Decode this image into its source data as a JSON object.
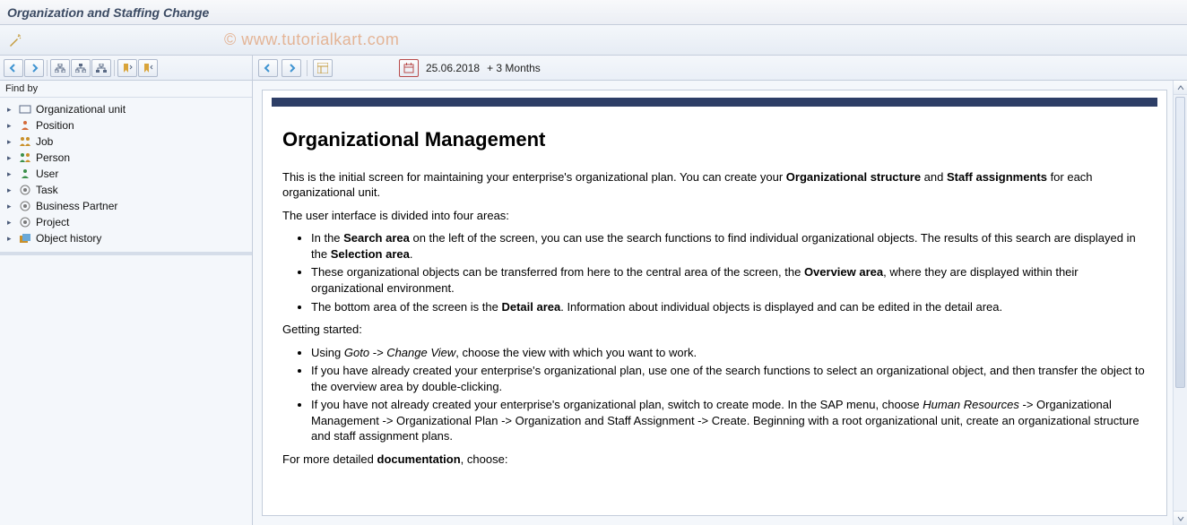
{
  "titlebar": {
    "title": "Organization and Staffing Change"
  },
  "watermark": "© www.tutorialkart.com",
  "left": {
    "findby_label": "Find by",
    "items": [
      {
        "label": "Organizational unit",
        "icon": "org-unit"
      },
      {
        "label": "Position",
        "icon": "position"
      },
      {
        "label": "Job",
        "icon": "job"
      },
      {
        "label": "Person",
        "icon": "person"
      },
      {
        "label": "User",
        "icon": "user"
      },
      {
        "label": "Task",
        "icon": "task"
      },
      {
        "label": "Business Partner",
        "icon": "bp"
      },
      {
        "label": "Project",
        "icon": "project"
      },
      {
        "label": "Object history",
        "icon": "history"
      }
    ]
  },
  "right_toolbar": {
    "date": "25.06.2018",
    "period": "+ 3 Months"
  },
  "content": {
    "heading": "Organizational Management",
    "p1a": "This is the initial screen for maintaining your enterprise's organizational plan. You can create your ",
    "p1b1": "Organizational structure",
    "p1c": " and ",
    "p1b2": "Staff assignments",
    "p1d": " for each organizational unit.",
    "p2": "The user interface is divided into four areas:",
    "li1a": "In the ",
    "li1b1": "Search area",
    "li1c": " on the left of the screen, you can use the search functions to find individual organizational objects. The results of this search are displayed in the ",
    "li1b2": "Selection area",
    "li1d": ".",
    "li2a": "These organizational objects can be transferred from here to the central area of the screen, the ",
    "li2b": "Overview area",
    "li2c": ", where they are displayed within their organizational environment.",
    "li3a": "The bottom area of the screen is the ",
    "li3b": "Detail area",
    "li3c": ". Information about individual objects is displayed and can be edited in the detail area.",
    "p3": "Getting started:",
    "gs1a": "Using ",
    "gs1i": "Goto -> Change View",
    "gs1b": ", choose the view with which you want to work.",
    "gs2": "If you have already created your enterprise's organizational plan, use one of the search functions to select an organizational object, and then transfer the object to the overview area by double-clicking.",
    "gs3a": "If you have not already created your enterprise's organizational plan, switch to create mode. In the SAP menu, choose ",
    "gs3i": "Human Resources",
    "gs3b": " -> Organizational Management -> Organizational Plan -> Organization and Staff Assignment -> Create. Beginning with a root organizational unit, create an organizational structure and staff assignment plans.",
    "p4a": "For more detailed ",
    "p4b": "documentation",
    "p4c": ", choose:"
  }
}
